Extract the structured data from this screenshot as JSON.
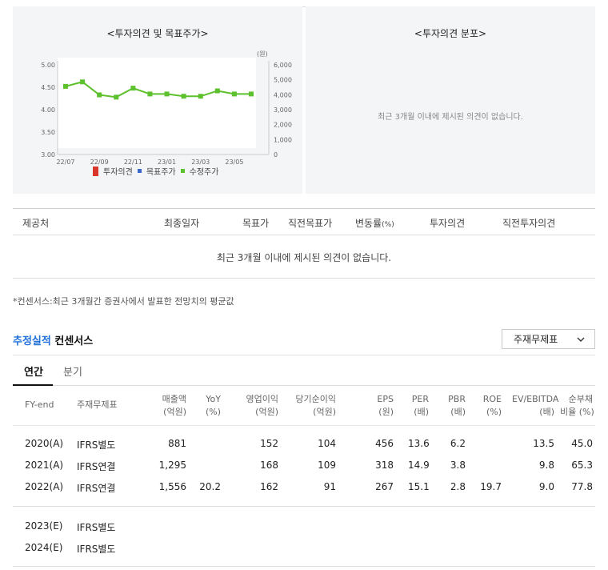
{
  "chart_panel": {
    "title": "<투자의견 및 목표주가>",
    "unit": "(원)",
    "legend": [
      {
        "label": "투자의견",
        "color": "#d9372b"
      },
      {
        "label": "목표주가",
        "color": "#3a67c8"
      },
      {
        "label": "수정주가",
        "color": "#5dc02d"
      }
    ]
  },
  "chart_data": {
    "type": "line",
    "x": [
      "22/07",
      "22/08",
      "22/09",
      "22/10",
      "22/11",
      "22/12",
      "23/01",
      "23/02",
      "23/03",
      "23/04",
      "23/05",
      "23/06"
    ],
    "xticks": [
      "22/07",
      "22/09",
      "22/11",
      "23/01",
      "23/03",
      "23/05"
    ],
    "series": [
      {
        "name": "수정주가",
        "color": "#5dc02d",
        "axis": "left",
        "values": [
          4.52,
          4.62,
          4.33,
          4.28,
          4.48,
          4.35,
          4.35,
          4.3,
          4.3,
          4.42,
          4.35,
          4.35
        ]
      }
    ],
    "y_left": {
      "ticks": [
        "5.00",
        "4.50",
        "4.00",
        "3.50",
        "3.00"
      ],
      "ylim": [
        3.0,
        5.0
      ]
    },
    "y_right": {
      "ticks": [
        "6,000",
        "5,000",
        "4,000",
        "3,000",
        "2,000",
        "1,000",
        "0"
      ],
      "ylim": [
        0,
        6000
      ]
    }
  },
  "dist_panel": {
    "title": "<투자의견 분포>",
    "empty": "최근 3개월 이내에 제시된 의견이 없습니다."
  },
  "opinion_table": {
    "headers": [
      "제공처",
      "최종일자",
      "목표가",
      "직전목표가",
      "변동률",
      "(%)",
      "투자의견",
      "직전투자의견"
    ],
    "empty": "최근 3개월 이내에 제시된 의견이 없습니다."
  },
  "footnote": "*컨센서스:최근 3개월간 증권사에서 발표한 전망치의 평균값",
  "section": {
    "title_accent": "추정실적",
    "title_rest": " 컨센서스",
    "dropdown": "주재무제표"
  },
  "tabs": [
    "연간",
    "분기"
  ],
  "fin_table": {
    "headers": {
      "fy": "FY-end",
      "std": "주재무제표",
      "cols": [
        [
          "매출액",
          "(억원)"
        ],
        [
          "YoY",
          "(%)"
        ],
        [
          "영업이익",
          "(억원)"
        ],
        [
          "당기순이익",
          "(억원)"
        ],
        [
          "EPS",
          "(원)"
        ],
        [
          "PER",
          "(배)"
        ],
        [
          "PBR",
          "(배)"
        ],
        [
          "ROE",
          "(%)"
        ],
        [
          "EV/EBITDA",
          "(배)"
        ],
        [
          "순부채",
          "비율 (%)"
        ]
      ]
    },
    "rows": [
      {
        "fy": "2020(A)",
        "std": "IFRS별도",
        "vals": [
          "881",
          "",
          "152",
          "104",
          "456",
          "13.6",
          "6.2",
          "",
          "13.5",
          "45.0"
        ]
      },
      {
        "fy": "2021(A)",
        "std": "IFRS연결",
        "vals": [
          "1,295",
          "",
          "168",
          "109",
          "318",
          "14.9",
          "3.8",
          "",
          "9.8",
          "65.3"
        ]
      },
      {
        "fy": "2022(A)",
        "std": "IFRS연결",
        "vals": [
          "1,556",
          "20.2",
          "162",
          "91",
          "267",
          "15.1",
          "2.8",
          "19.7",
          "9.0",
          "77.8"
        ]
      }
    ],
    "est_rows": [
      {
        "fy": "2023(E)",
        "std": "IFRS별도"
      },
      {
        "fy": "2024(E)",
        "std": "IFRS별도"
      }
    ]
  },
  "colors": {
    "accent": "#1e6fd9",
    "panel_bg": "#f4f5f7",
    "line": "#5dc02d"
  }
}
